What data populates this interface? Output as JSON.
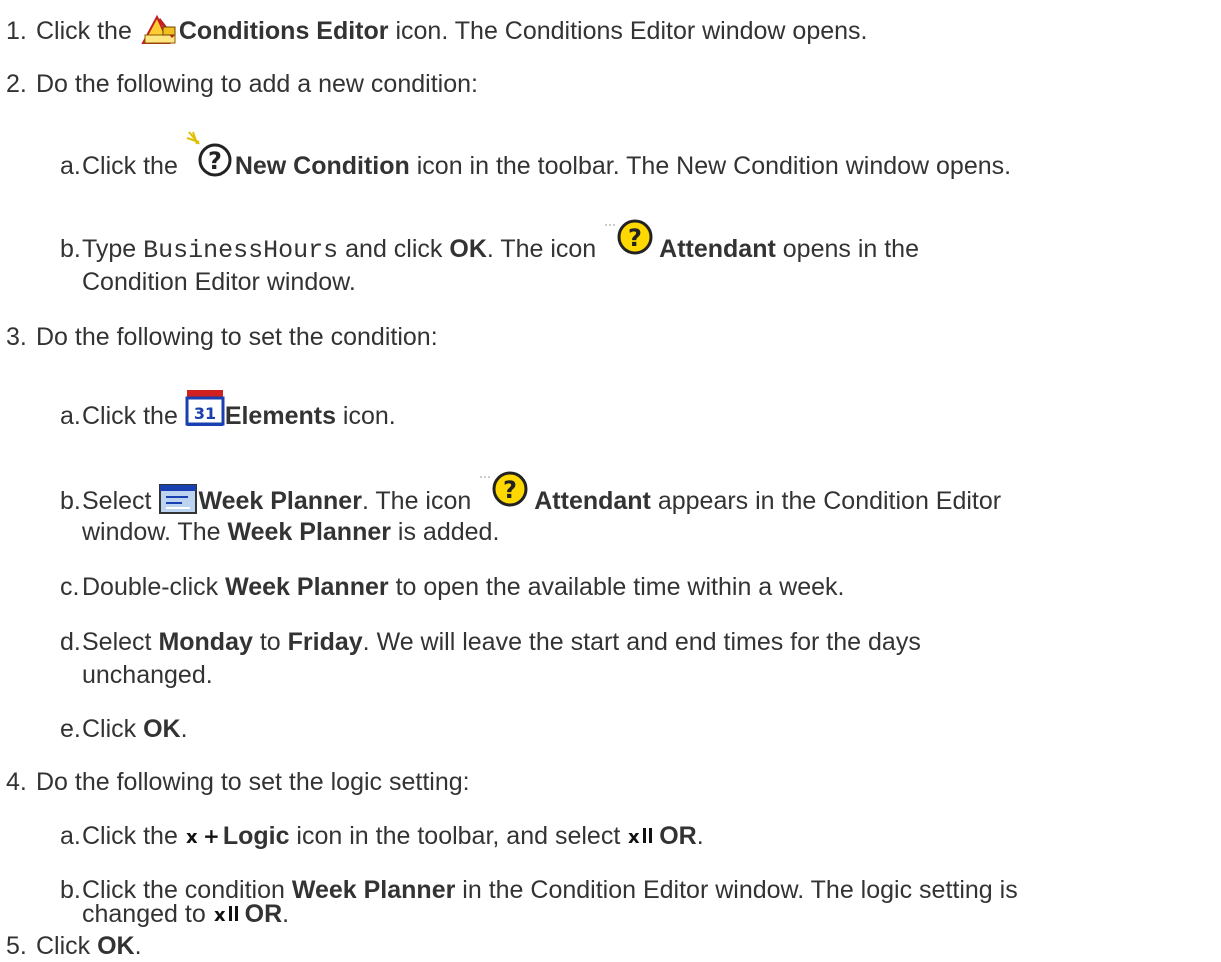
{
  "steps": {
    "s1": {
      "num": "1.",
      "t1": "Click the ",
      "b1": "Conditions Editor",
      "t2": " icon. The Conditions Editor window opens."
    },
    "s2": {
      "num": "2.",
      "text": "Do the following to add a new condition:"
    },
    "s2a": {
      "letter": "a.",
      "t1": "Click the ",
      "b1": "New Condition",
      "t2": " icon in the toolbar. The New Condition window opens."
    },
    "s2b": {
      "letter": "b.",
      "t1": "Type ",
      "code": "BusinessHours",
      "t2": " and click ",
      "b1": "OK",
      "t3": ". The icon ",
      "b2": "Attendant",
      "t4": " opens in the",
      "t5": "Condition Editor window."
    },
    "s3": {
      "num": "3.",
      "text": "Do the following to set the condition:"
    },
    "s3a": {
      "letter": "a.",
      "t1": "Click the ",
      "b1": "Elements",
      "t2": " icon."
    },
    "s3b": {
      "letter": "b.",
      "t1": "Select ",
      "b1": "Week Planner",
      "t2": ". The icon ",
      "b2": "Attendant",
      "t3": " appears in the Condition Editor",
      "t4": "window. The ",
      "b3": "Week Planner",
      "t5": " is added."
    },
    "s3c": {
      "letter": "c.",
      "t1": "Double-click ",
      "b1": "Week Planner",
      "t2": " to open the available time within a week."
    },
    "s3d": {
      "letter": "d.",
      "t1": "Select ",
      "b1": "Monday",
      "t2": " to ",
      "b2": "Friday",
      "t3": ". We will leave the start and end times for the days",
      "t4": "unchanged."
    },
    "s3e": {
      "letter": "e.",
      "t1": "Click ",
      "b1": "OK",
      "t2": "."
    },
    "s4": {
      "num": "4.",
      "text": "Do the following to set the logic setting:"
    },
    "s4a": {
      "letter": "a.",
      "t1": "Click the ",
      "b1": "Logic",
      "t2": " icon in the toolbar, and select ",
      "b2": "OR",
      "t3": "."
    },
    "s4b": {
      "letter": "b.",
      "t1": "Click the condition ",
      "b1": "Week Planner",
      "t2": " in the Condition Editor window. The logic setting is",
      "t3": "changed to ",
      "b2": "OR",
      "t4": "."
    },
    "s5": {
      "num": "5.",
      "t1": "Click ",
      "b1": "OK",
      "t2": "."
    }
  },
  "icons": [
    "conditions-editor-icon",
    "new-condition-icon",
    "attendant-icon",
    "elements-calendar-icon",
    "week-planner-icon",
    "logic-icon",
    "or-icon"
  ],
  "colors": {
    "text": "#333333",
    "attendant_yellow": "#ffd800",
    "calendar_blue": "#1a3fb0"
  }
}
